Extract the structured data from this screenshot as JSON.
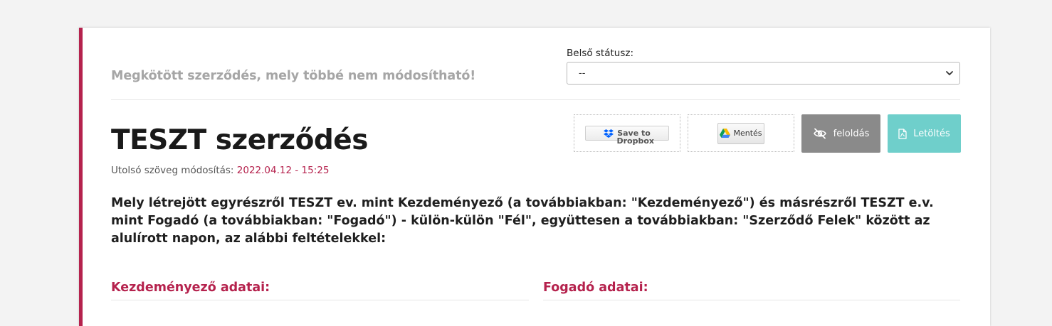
{
  "contract": {
    "locked_note": "Megkötött szerződés, mely többé nem módosítható!",
    "title": "TESZT szerződés",
    "modified_label": "Utolsó szöveg módosítás:",
    "modified_date": "2022.04.12 - 15:25",
    "intro": "Mely létrejött egyrészről TESZT ev. mint Kezdeményező (a továbbiakban: \"Kezdeményező\") és másrészről TESZT e.v. mint Fogadó (a továbbiakban: \"Fogadó\") - külön-külön \"Fél\", együttesen a továbbiakban: \"Szerződő Felek\" között az alulírott napon, az alábbi feltételekkel:"
  },
  "status": {
    "label": "Belső státusz:",
    "selected": "--"
  },
  "actions": {
    "dropbox_label": "Save to Dropbox",
    "gdrive_label": "Mentés",
    "unlock_label": "feloldás",
    "download_label": "Letöltés"
  },
  "sections": {
    "initiator": "Kezdeményező adatai:",
    "receiver": "Fogadó adatai:"
  },
  "colors": {
    "accent": "#b5224d",
    "unlock_button": "#8a8a8a",
    "download_button": "#6fcfcb"
  },
  "icons": {
    "dropbox": "dropbox-icon",
    "gdrive": "google-drive-icon",
    "unlock": "eye-slash-icon",
    "download": "pdf-file-icon",
    "select": "chevron-down-icon"
  }
}
